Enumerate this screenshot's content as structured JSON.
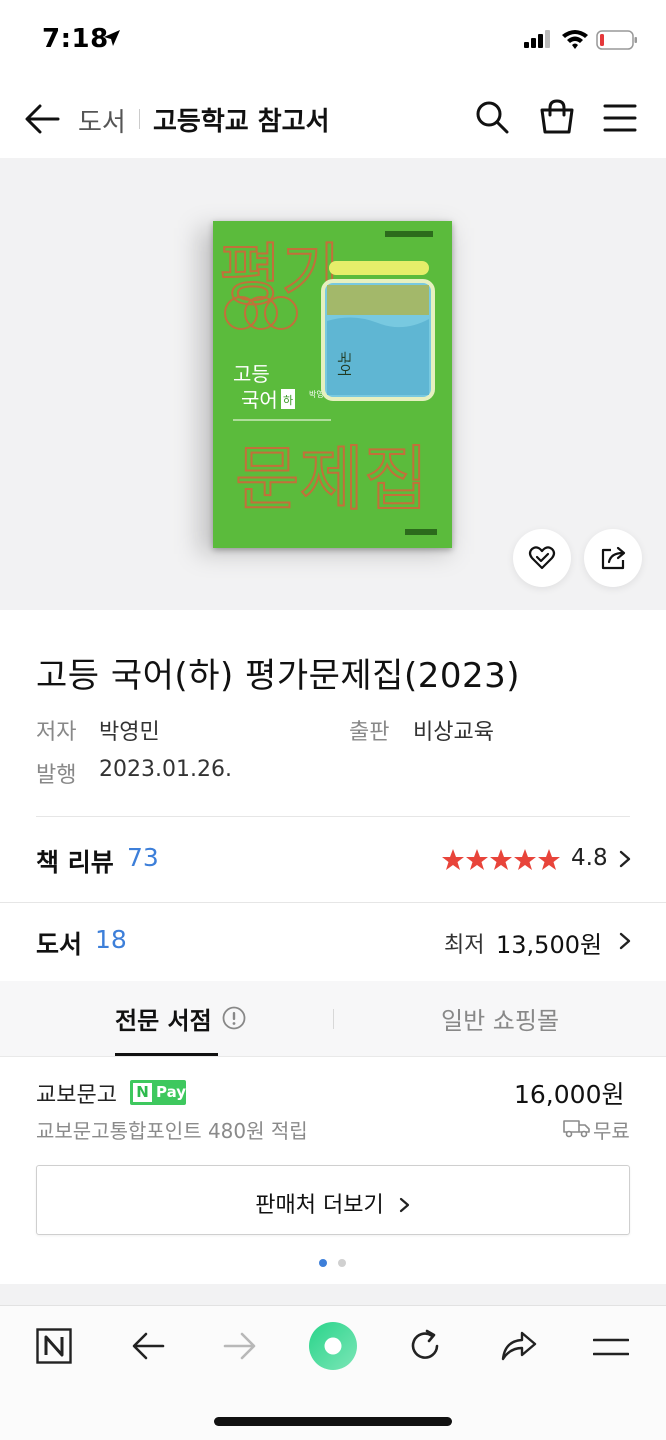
{
  "status_bar": {
    "time": "7:18"
  },
  "nav": {
    "breadcrumb_parent": "도서",
    "breadcrumb_current": "고등학교 참고서"
  },
  "book_cover": {
    "big_text_top": "평가",
    "big_text_bottom": "문제집",
    "subject_line1": "고등",
    "subject_line2": "국어",
    "subject_badge": "하",
    "author_small": "박영민 외",
    "spine_label": "국어",
    "colors": {
      "cover": "#5bbb3c",
      "lettering": "#c2703a"
    }
  },
  "product": {
    "title": "고등 국어(하) 평가문제집(2023)",
    "author_label": "저자",
    "author": "박영민",
    "publisher_label": "출판",
    "publisher": "비상교육",
    "date_label": "발행",
    "date": "2023.01.26."
  },
  "reviews": {
    "label": "책 리뷰",
    "count": "73",
    "rating": "4.8",
    "stars_filled": 5
  },
  "offers": {
    "label": "도서",
    "count": "18",
    "lowest_label": "최저",
    "lowest_price": "13,500원"
  },
  "tabs": [
    {
      "label": "전문 서점",
      "active": true
    },
    {
      "label": "일반 쇼핑몰",
      "active": false
    }
  ],
  "seller": {
    "name": "교보문고",
    "npay_n": "N",
    "npay_label": "Pay",
    "price": "16,000원",
    "points": "교보문고통합포인트 480원 적립",
    "shipping": "무료"
  },
  "more_button": "판매처 더보기",
  "pagination": {
    "current": 1,
    "total": 2
  },
  "colors": {
    "accent_blue": "#3d7fd9",
    "star_red": "#e8443a",
    "npay_green": "#3ec85e"
  }
}
